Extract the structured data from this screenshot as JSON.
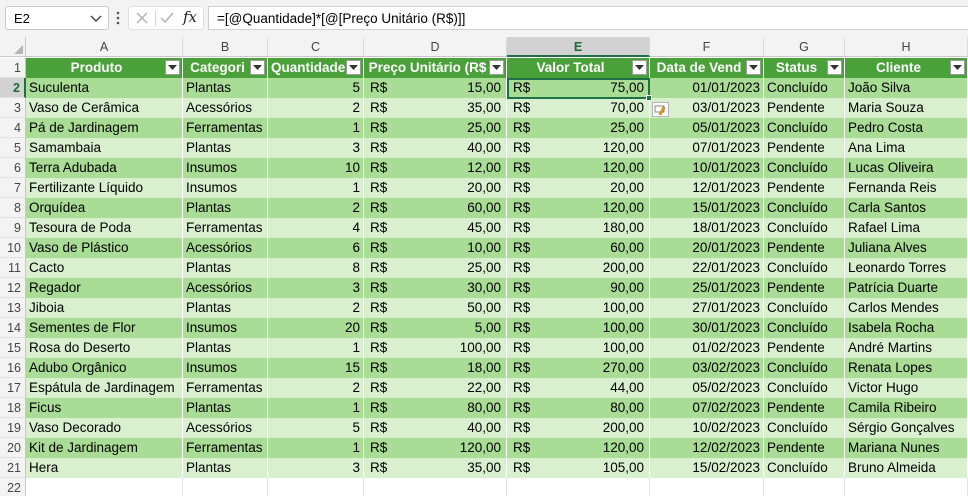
{
  "name_box": {
    "value": "E2"
  },
  "formula_bar": {
    "fx_label": "fx",
    "formula": "=[@Quantidade]*[@[Preço Unitário (R$)]]"
  },
  "columns": [
    "A",
    "B",
    "C",
    "D",
    "E",
    "F",
    "G",
    "H"
  ],
  "selected_column": "E",
  "selected_row": "2",
  "row_numbers": [
    "1",
    "2",
    "3",
    "4",
    "5",
    "6",
    "7",
    "8",
    "9",
    "10",
    "11",
    "12",
    "13",
    "14",
    "15",
    "16",
    "17",
    "18",
    "19",
    "20",
    "21",
    "22"
  ],
  "table": {
    "headers": [
      "Produto",
      "Categori",
      "Quantidade",
      "Preço Unitário (R$",
      "Valor Total",
      "Data de Vend",
      "Status",
      "Cliente"
    ],
    "currency": "R$",
    "rows": [
      [
        "Suculenta",
        "Plantas",
        "5",
        "15,00",
        "75,00",
        "01/01/2023",
        "Concluído",
        "João Silva"
      ],
      [
        "Vaso de Cerâmica",
        "Acessórios",
        "2",
        "35,00",
        "70,00",
        "03/01/2023",
        "Pendente",
        "Maria Souza"
      ],
      [
        "Pá de Jardinagem",
        "Ferramentas",
        "1",
        "25,00",
        "25,00",
        "05/01/2023",
        "Concluído",
        "Pedro Costa"
      ],
      [
        "Samambaia",
        "Plantas",
        "3",
        "40,00",
        "120,00",
        "07/01/2023",
        "Pendente",
        "Ana Lima"
      ],
      [
        "Terra Adubada",
        "Insumos",
        "10",
        "12,00",
        "120,00",
        "10/01/2023",
        "Concluído",
        "Lucas Oliveira"
      ],
      [
        "Fertilizante Líquido",
        "Insumos",
        "1",
        "20,00",
        "20,00",
        "12/01/2023",
        "Pendente",
        "Fernanda Reis"
      ],
      [
        "Orquídea",
        "Plantas",
        "2",
        "60,00",
        "120,00",
        "15/01/2023",
        "Concluído",
        "Carla Santos"
      ],
      [
        "Tesoura de Poda",
        "Ferramentas",
        "4",
        "45,00",
        "180,00",
        "18/01/2023",
        "Concluído",
        "Rafael Lima"
      ],
      [
        "Vaso de Plástico",
        "Acessórios",
        "6",
        "10,00",
        "60,00",
        "20/01/2023",
        "Pendente",
        "Juliana Alves"
      ],
      [
        "Cacto",
        "Plantas",
        "8",
        "25,00",
        "200,00",
        "22/01/2023",
        "Concluído",
        "Leonardo Torres"
      ],
      [
        "Regador",
        "Acessórios",
        "3",
        "30,00",
        "90,00",
        "25/01/2023",
        "Pendente",
        "Patrícia Duarte"
      ],
      [
        "Jiboia",
        "Plantas",
        "2",
        "50,00",
        "100,00",
        "27/01/2023",
        "Concluído",
        "Carlos Mendes"
      ],
      [
        "Sementes de Flor",
        "Insumos",
        "20",
        "5,00",
        "100,00",
        "30/01/2023",
        "Concluído",
        "Isabela Rocha"
      ],
      [
        "Rosa do Deserto",
        "Plantas",
        "1",
        "100,00",
        "100,00",
        "01/02/2023",
        "Pendente",
        "André Martins"
      ],
      [
        "Adubo Orgânico",
        "Insumos",
        "15",
        "18,00",
        "270,00",
        "03/02/2023",
        "Concluído",
        "Renata Lopes"
      ],
      [
        "Espátula de Jardinagem",
        "Ferramentas",
        "2",
        "22,00",
        "44,00",
        "05/02/2023",
        "Concluído",
        "Victor Hugo"
      ],
      [
        "Ficus",
        "Plantas",
        "1",
        "80,00",
        "80,00",
        "07/02/2023",
        "Pendente",
        "Camila Ribeiro"
      ],
      [
        "Vaso Decorado",
        "Acessórios",
        "5",
        "40,00",
        "200,00",
        "10/02/2023",
        "Concluído",
        "Sérgio Gonçalves"
      ],
      [
        "Kit de Jardinagem",
        "Ferramentas",
        "1",
        "120,00",
        "120,00",
        "12/02/2023",
        "Pendente",
        "Mariana Nunes"
      ],
      [
        "Hera",
        "Plantas",
        "3",
        "35,00",
        "105,00",
        "15/02/2023",
        "Concluído",
        "Bruno Almeida"
      ]
    ]
  },
  "colors": {
    "header_green": "#4aa13a",
    "band_dark": "#a9dc95",
    "band_light": "#d9f0cf",
    "selection_green": "#1e7145"
  },
  "icons": [
    "chevron-down-icon",
    "vertical-dots-icon",
    "cancel-x-icon",
    "enter-check-icon",
    "fx-icon",
    "filter-dropdown-icon",
    "autofill-options-icon",
    "select-all-icon"
  ]
}
